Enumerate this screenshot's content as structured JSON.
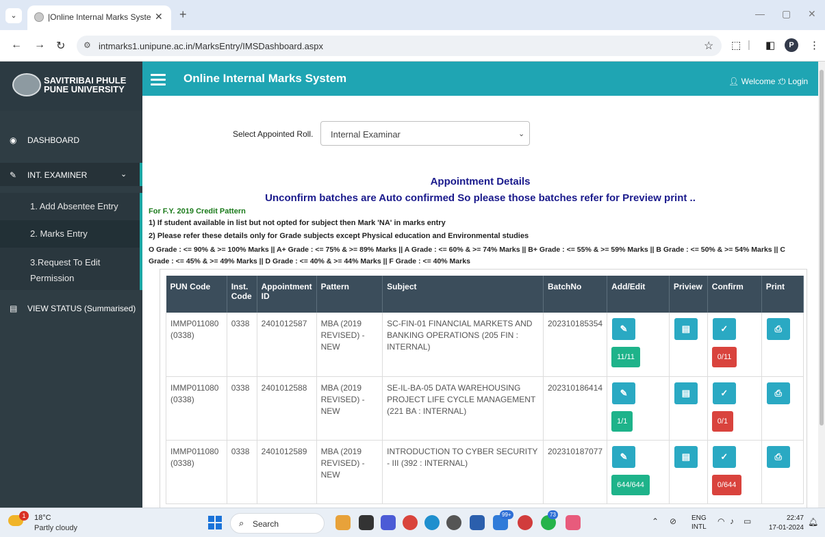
{
  "browser": {
    "tab_title": "|Online Internal Marks System |",
    "tab_close": "✕",
    "new_tab": "+",
    "url": "intmarks1.unipune.ac.in/MarksEntry/IMSDashboard.aspx",
    "profile_initial": "P"
  },
  "sidebar": {
    "brand_line1": "SAVITRIBAI PHULE",
    "brand_line2": "PUNE UNIVERSITY",
    "dashboard": "DASHBOARD",
    "int_examiner": "INT. EXAMINER",
    "sub_items": [
      "1. Add Absentee Entry",
      "2. Marks Entry"
    ],
    "request_line1": "3.Request To Edit",
    "request_line2": "Permission",
    "view_status": "VIEW STATUS (Summarised)"
  },
  "header": {
    "title": "Online Internal Marks System",
    "welcome": "Welcome :",
    "login": "Login"
  },
  "main": {
    "roll_label": "Select Appointed Roll.",
    "roll_value": "Internal Examinar",
    "appointment_title": "Appointment Details",
    "appointment_notice": "Unconfirm batches are Auto confirmed So please those batches refer for Preview print ..",
    "fy_pattern": "For F.Y. 2019 Credit Pattern",
    "note1": "1) If student available in list but not opted for subject then Mark 'NA' in marks entry",
    "note2": "2) Please refer these details only for Grade subjects except Physical education and Environmental studies",
    "grades": "O Grade : <= 90% & >= 100% Marks || A+ Grade : <= 75% & >= 89% Marks || A Grade : <= 60% & >= 74% Marks || B+ Grade : <= 55% & >= 59% Marks || B Grade : <= 50% & >= 54% Marks || C Grade : <= 45% & >= 49% Marks || D Grade : <= 40% & >= 44% Marks || F Grade : <= 40% Marks"
  },
  "table": {
    "headers": [
      "PUN Code",
      "Inst. Code",
      "Appointment ID",
      "Pattern",
      "Subject",
      "BatchNo",
      "Add/Edit",
      "Priview",
      "Confirm",
      "Print"
    ],
    "rows": [
      {
        "pun_code": "IMMP011080 (0338)",
        "inst_code": "0338",
        "appointment_id": "2401012587",
        "pattern": "MBA (2019 REVISED) - NEW",
        "subject": "SC-FIN-01 FINANCIAL MARKETS AND BANKING OPERATIONS (205 FIN : INTERNAL)",
        "batch_no": "202310185354",
        "add_count": "11/11",
        "confirm_count": "0/11"
      },
      {
        "pun_code": "IMMP011080 (0338)",
        "inst_code": "0338",
        "appointment_id": "2401012588",
        "pattern": "MBA (2019 REVISED) - NEW",
        "subject": "SE-IL-BA-05 DATA WAREHOUSING PROJECT LIFE CYCLE MANAGEMENT (221 BA : INTERNAL)",
        "batch_no": "202310186414",
        "add_count": "1/1",
        "confirm_count": "0/1"
      },
      {
        "pun_code": "IMMP011080 (0338)",
        "inst_code": "0338",
        "appointment_id": "2401012589",
        "pattern": "MBA (2019 REVISED) - NEW",
        "subject": "INTRODUCTION TO CYBER SECURITY - III (392 : INTERNAL)",
        "batch_no": "202310187077",
        "add_count": "644/644",
        "confirm_count": "0/644"
      }
    ]
  },
  "taskbar": {
    "temp": "18°C",
    "condition": "Partly cloudy",
    "weather_badge": "1",
    "search": "Search",
    "badge_99": "99+",
    "badge_73": "73",
    "lang1": "ENG",
    "lang2": "INTL",
    "time": "22:47",
    "date": "17-01-2024"
  },
  "colors": {
    "header_teal": "#1fa5b3",
    "sidebar": "#2f3d44",
    "table_header": "#3b4d5b",
    "green_badge": "#1eb38a",
    "red_badge": "#d9433d",
    "action_blue": "#2aa9c3",
    "notice_blue": "#1a1a8c"
  },
  "icons": {
    "add_edit": "edit-icon",
    "preview": "document-icon",
    "confirm": "confirm-icon",
    "print": "print-icon"
  }
}
